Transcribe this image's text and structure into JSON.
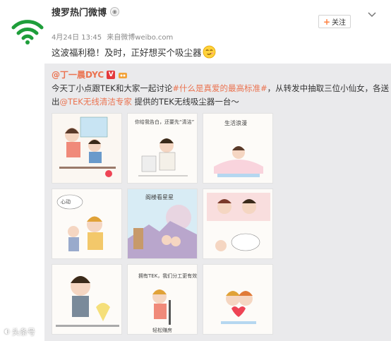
{
  "post": {
    "author": "搜罗热门微博",
    "badge_icon": "verified-badge-icon",
    "date": "4月24日 13:45",
    "source_prefix": "来自",
    "source": "微博weibo.com",
    "text": "这波福利稳！及时，正好想买个吸尘器",
    "follow_label": "关注",
    "accent_color": "#eb7350",
    "follow_plus_color": "#ff8140"
  },
  "repost": {
    "author": "@丁一晨DYC",
    "line1_prefix": "今天丁小点跟TEK和大家一起讨论",
    "line1_topic": "#什么是真爱的最高标准#",
    "line1_suffix": "，从转发中抽取三位小仙女，各送",
    "line2_prefix": "出",
    "line2_mention": "@TEK无线清洁专家",
    "line2_suffix": " 提供的TEK无线吸尘器一台～",
    "images": [
      {
        "caption": ""
      },
      {
        "caption": "你给我告白，还要先“清洁”"
      },
      {
        "caption": "生活浪漫"
      },
      {
        "caption": "心动"
      },
      {
        "caption": "阁楼看星星"
      },
      {
        "caption": ""
      },
      {
        "caption": ""
      },
      {
        "caption": "拥有TEK，我们分工更有效"
      },
      {
        "caption": "轻松赚房"
      }
    ]
  },
  "watermark": "头条号"
}
